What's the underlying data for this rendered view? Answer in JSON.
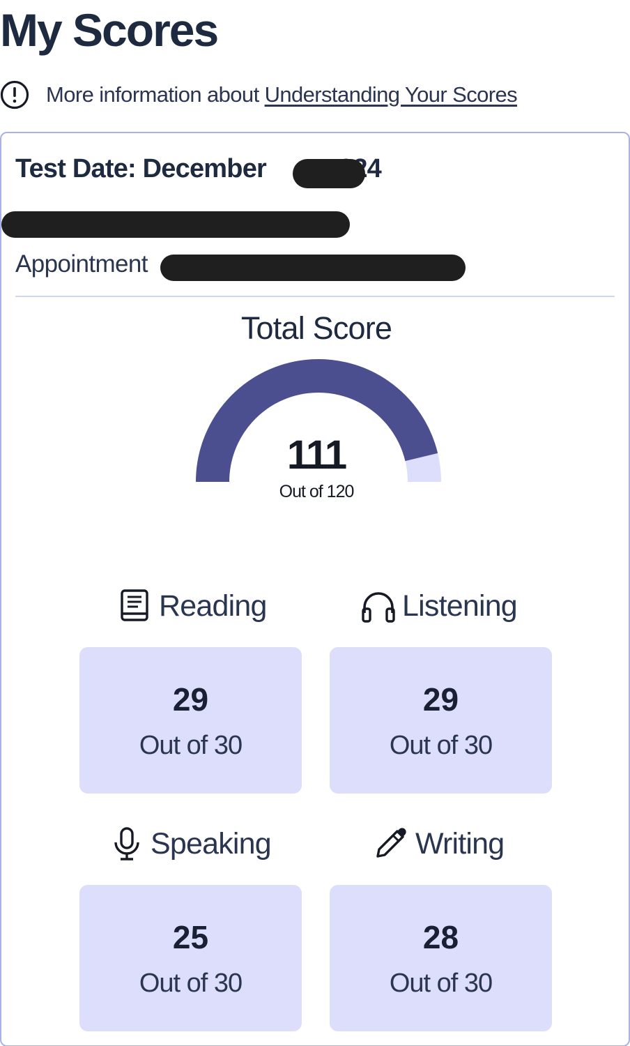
{
  "page": {
    "title": "My Scores"
  },
  "info": {
    "icon": "alert-circle-icon",
    "prefix": "More information about ",
    "link_text": "Understanding Your Scores"
  },
  "card": {
    "test_date_prefix": "Test Date: December",
    "test_date_suffix": "024",
    "appointment_label": "Appointment"
  },
  "total": {
    "title": "Total Score",
    "value": "111",
    "max_text": "Out of 120",
    "score": 111,
    "max": 120
  },
  "sections": [
    {
      "label": "Reading",
      "icon": "book-icon",
      "value": "29",
      "max_text": "Out of 30"
    },
    {
      "label": "Listening",
      "icon": "headphones-icon",
      "value": "29",
      "max_text": "Out of 30"
    },
    {
      "label": "Speaking",
      "icon": "microphone-icon",
      "value": "25",
      "max_text": "Out of 30"
    },
    {
      "label": "Writing",
      "icon": "pencil-icon",
      "value": "28",
      "max_text": "Out of 30"
    }
  ],
  "colors": {
    "gauge_fill": "#4c4f8f",
    "gauge_track": "#dcdefc",
    "score_box": "#dcdefc",
    "card_border": "#aab0ea",
    "text_primary": "#1e2a40"
  }
}
